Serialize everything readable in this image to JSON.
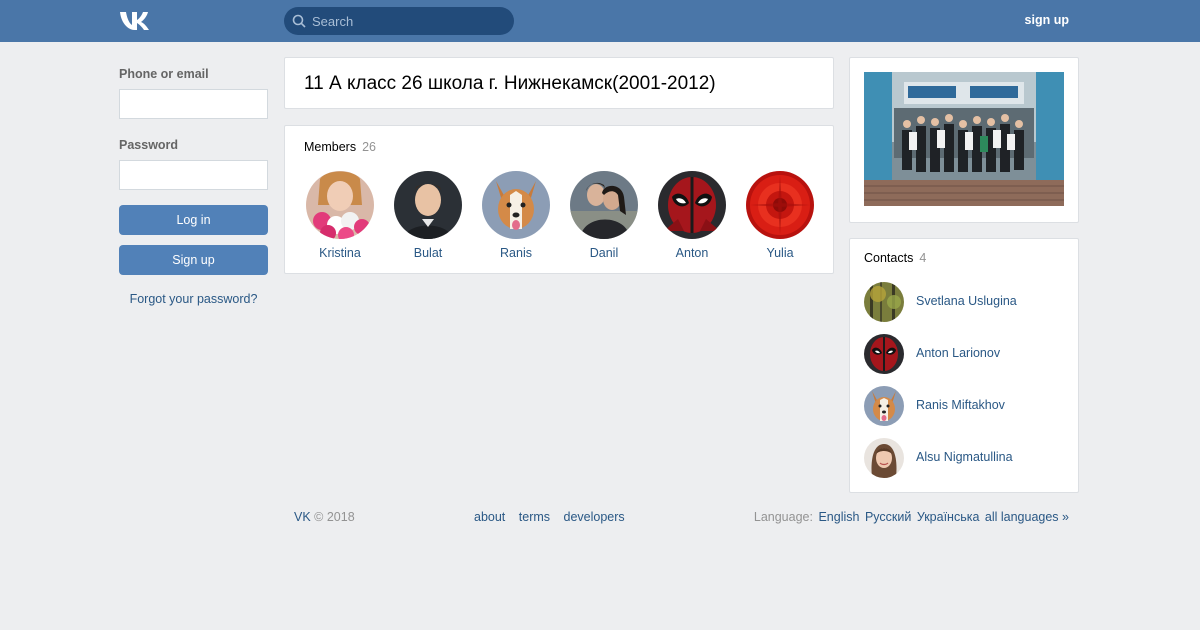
{
  "header": {
    "logo": "VK",
    "search_placeholder": "Search",
    "signup_label": "sign up",
    "colors": {
      "bar": "#4a76a8",
      "search_bg": "#224b7a"
    }
  },
  "login": {
    "phone_label": "Phone or email",
    "phone_value": "",
    "password_label": "Password",
    "password_value": "",
    "login_button": "Log in",
    "signup_button": "Sign up",
    "forgot_link": "Forgot your password?"
  },
  "group": {
    "title": "11 А класс 26 школа г. Нижнекамск(2001-2012)"
  },
  "members": {
    "label": "Members",
    "count": "26",
    "items": [
      {
        "name": "Kristina",
        "icon": "avatar-flowers"
      },
      {
        "name": "Bulat",
        "icon": "avatar-man"
      },
      {
        "name": "Ranis",
        "icon": "avatar-dog"
      },
      {
        "name": "Danil",
        "icon": "avatar-couple"
      },
      {
        "name": "Anton",
        "icon": "avatar-mask"
      },
      {
        "name": "Yulia",
        "icon": "avatar-red-flower"
      }
    ]
  },
  "contacts": {
    "label": "Contacts",
    "count": "4",
    "items": [
      {
        "name": "Svetlana Uslugina",
        "icon": "avatar-forest"
      },
      {
        "name": "Anton Larionov",
        "icon": "avatar-mask"
      },
      {
        "name": "Ranis Miftakhov",
        "icon": "avatar-dog"
      },
      {
        "name": "Alsu Nigmatullina",
        "icon": "avatar-woman"
      }
    ]
  },
  "footer": {
    "brand": "VK",
    "copyright": "© 2018",
    "links": [
      "about",
      "terms",
      "developers"
    ],
    "language_label": "Language:",
    "languages": [
      "English",
      "Русский",
      "Українська",
      "all languages »"
    ]
  }
}
